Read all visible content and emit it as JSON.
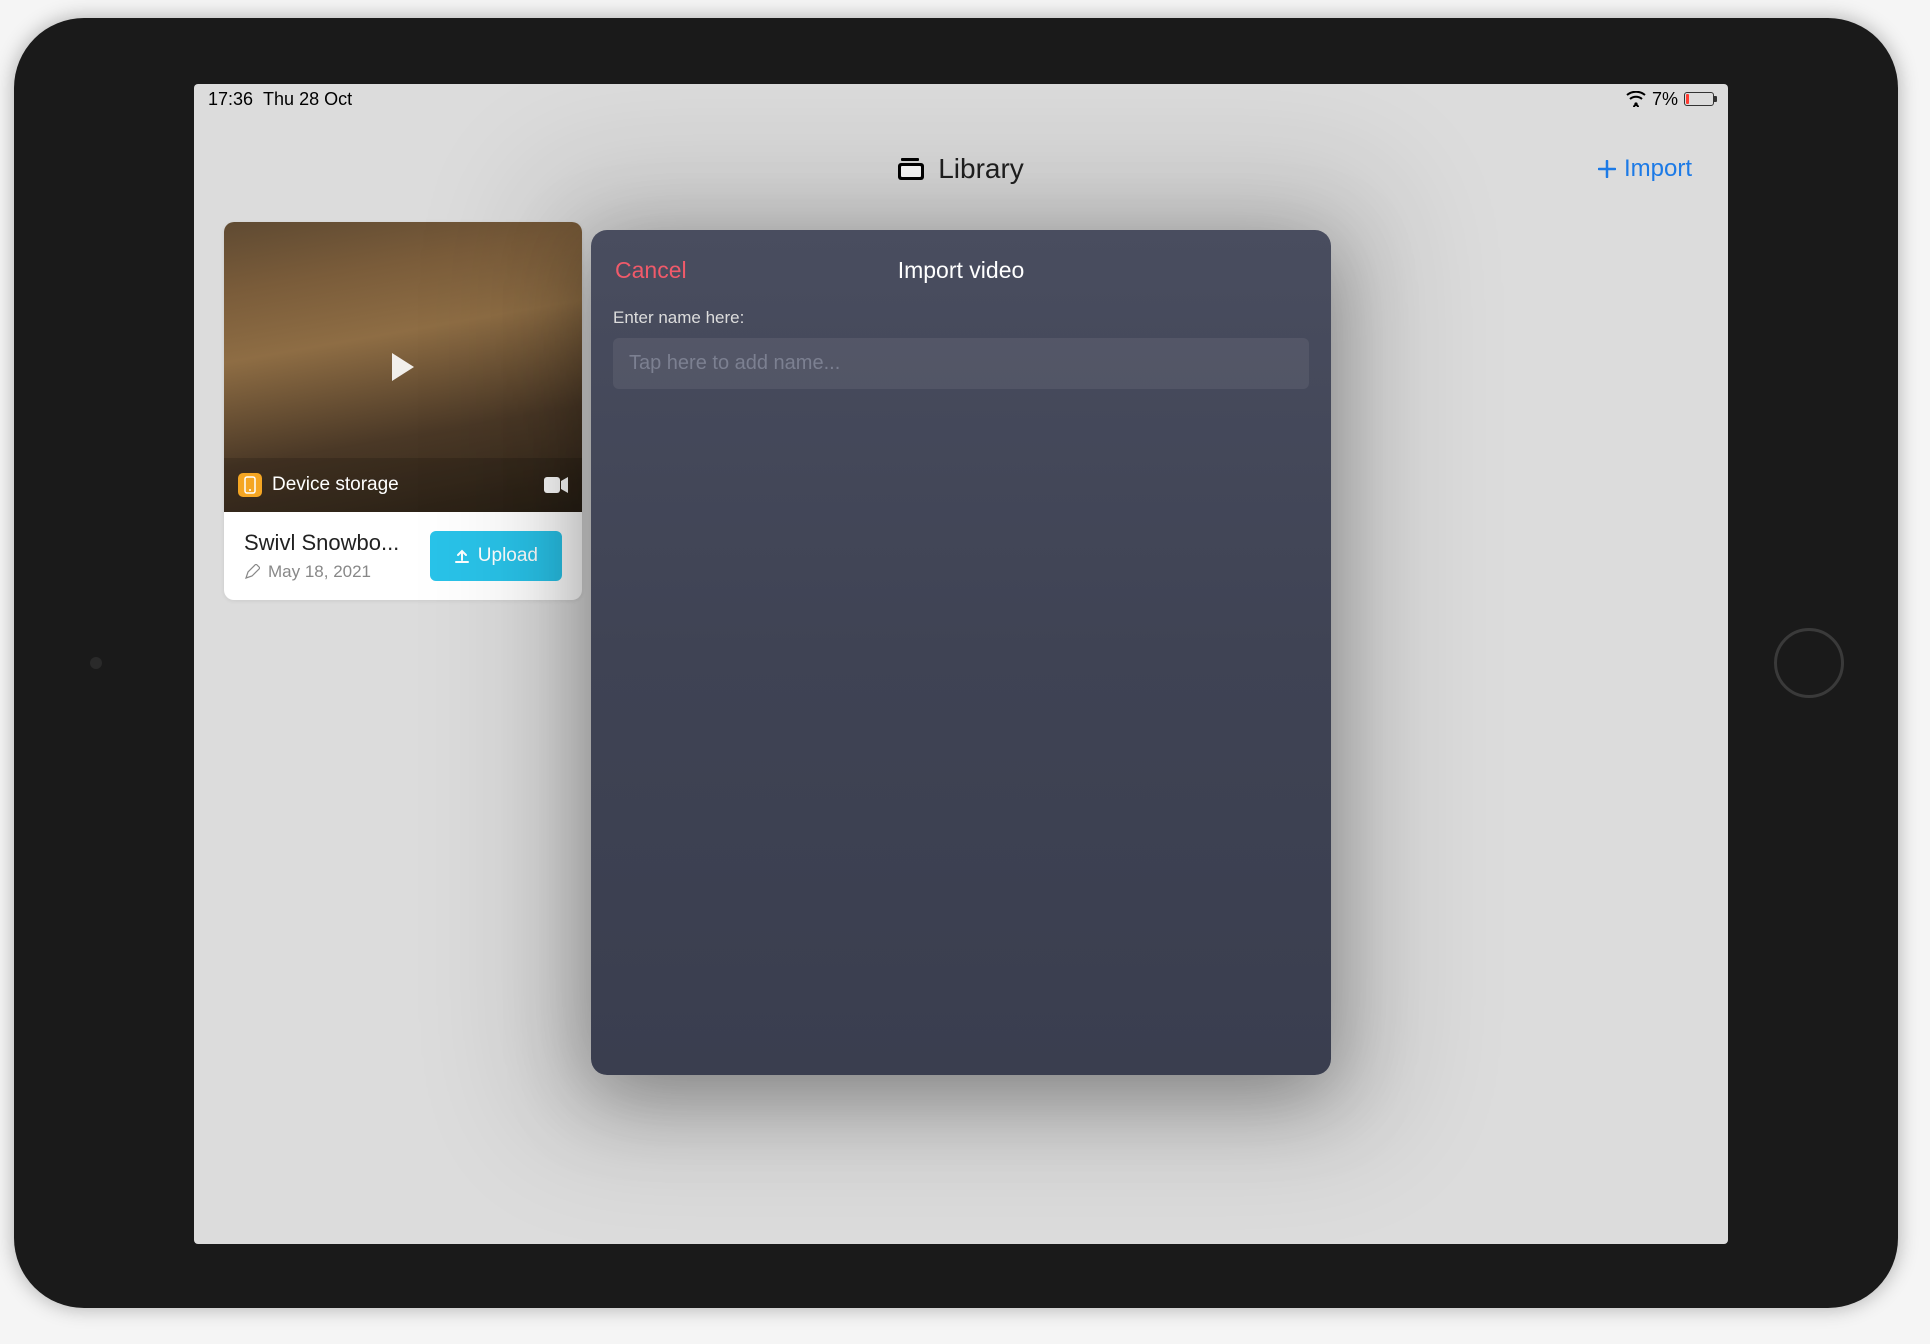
{
  "status": {
    "time": "17:36",
    "date": "Thu 28 Oct",
    "battery": "7%"
  },
  "header": {
    "title": "Library",
    "import_label": "Import"
  },
  "video_card": {
    "storage_label": "Device storage",
    "title": "Swivl Snowbo...",
    "date": "May 18, 2021",
    "upload_label": "Upload"
  },
  "modal": {
    "cancel_label": "Cancel",
    "title": "Import video",
    "field_label": "Enter name here:",
    "placeholder": "Tap here to add name..."
  }
}
